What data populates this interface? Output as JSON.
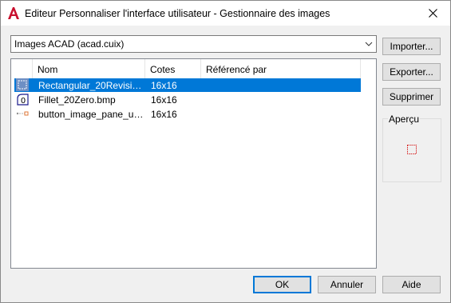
{
  "window": {
    "title": "Editeur Personnaliser l'interface utilisateur - Gestionnaire des images"
  },
  "combo": {
    "selected": "Images ACAD (acad.cuix)"
  },
  "list": {
    "columns": [
      "Nom",
      "Cotes",
      "Référencé par"
    ],
    "rows": [
      {
        "name": "Rectangular_20Revision...",
        "size": "16x16",
        "referenced_by": "",
        "icon": "revision-cloud-icon",
        "selected": true
      },
      {
        "name": "Fillet_20Zero.bmp",
        "size": "16x16",
        "referenced_by": "",
        "icon": "fillet-zero-icon",
        "selected": false
      },
      {
        "name": "button_image_pane_use...",
        "size": "16x16",
        "referenced_by": "",
        "icon": "pane-button-icon",
        "selected": false
      }
    ]
  },
  "side_buttons": {
    "import": "Importer...",
    "export": "Exporter...",
    "delete": "Supprimer"
  },
  "preview": {
    "label": "Aperçu",
    "icon": "revision-cloud-icon"
  },
  "footer": {
    "ok": "OK",
    "cancel": "Annuler",
    "help": "Aide"
  },
  "colors": {
    "selection": "#0078d7",
    "icon_red": "#d62020"
  }
}
